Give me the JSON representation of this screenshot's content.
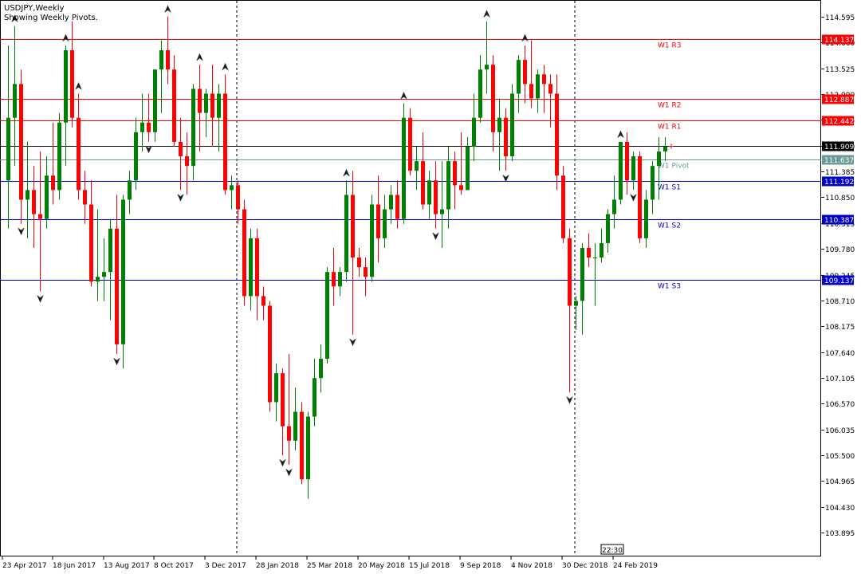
{
  "header": {
    "symbol_line": "USDJPY,Weekly",
    "indicator_line": "Showing Weekly Pivots."
  },
  "clock_label": "22:30",
  "colors": {
    "bull": "#008000",
    "bear": "#ff0000",
    "resistance": "#ff0000",
    "support": "#0000cc",
    "pivot": "#6a9a9a",
    "current": "#000000"
  },
  "chart_data": {
    "type": "candlestick",
    "symbol": "USDJPY",
    "timeframe": "Weekly",
    "ylim": [
      103.4,
      115.0
    ],
    "y_ticks": [
      "114.595",
      "114.060",
      "113.525",
      "112.990",
      "112.455",
      "111.920",
      "111.385",
      "110.850",
      "110.315",
      "109.780",
      "109.245",
      "108.710",
      "108.175",
      "107.640",
      "107.105",
      "106.570",
      "106.035",
      "105.500",
      "104.965",
      "104.430",
      "103.895"
    ],
    "x_ticks": [
      "23 Apr 2017",
      "18 Jun 2017",
      "13 Aug 2017",
      "8 Oct 2017",
      "3 Dec 2017",
      "28 Jan 2018",
      "25 Mar 2018",
      "20 May 2018",
      "15 Jul 2018",
      "9 Sep 2018",
      "4 Nov 2018",
      "30 Dec 2018",
      "24 Feb 2019"
    ],
    "period_separators": [
      "31 Dec 2017",
      "30 Dec 2018"
    ],
    "pivot_levels": [
      {
        "label": "W1 R3",
        "value": 114.137,
        "value_label": "114.137",
        "kind": "resistance"
      },
      {
        "label": "W1 R2",
        "value": 112.887,
        "value_label": "112.887",
        "kind": "resistance"
      },
      {
        "label": "W1 R1",
        "value": 112.442,
        "value_label": "112.442",
        "kind": "resistance"
      },
      {
        "label": "W1 Pivot",
        "value": 111.637,
        "value_label": "111.637",
        "kind": "pivot"
      },
      {
        "label": "W1 S1",
        "value": 111.192,
        "value_label": "111.192",
        "kind": "support"
      },
      {
        "label": "W1 S2",
        "value": 110.387,
        "value_label": "110.387",
        "kind": "support"
      },
      {
        "label": "W1 S3",
        "value": 109.137,
        "value_label": "109.137",
        "kind": "support"
      }
    ],
    "current_price": 111.909,
    "current_price_label": "111.909",
    "candles": [
      {
        "o": 111.2,
        "h": 114.0,
        "l": 110.2,
        "c": 112.5
      },
      {
        "o": 112.5,
        "h": 114.4,
        "l": 111.5,
        "c": 113.2
      },
      {
        "o": 113.2,
        "h": 113.5,
        "l": 110.3,
        "c": 110.8
      },
      {
        "o": 110.8,
        "h": 112.0,
        "l": 110.0,
        "c": 111.0
      },
      {
        "o": 111.0,
        "h": 111.5,
        "l": 109.8,
        "c": 110.5
      },
      {
        "o": 110.5,
        "h": 111.8,
        "l": 108.9,
        "c": 110.4
      },
      {
        "o": 110.4,
        "h": 111.7,
        "l": 110.2,
        "c": 111.3
      },
      {
        "o": 111.3,
        "h": 112.4,
        "l": 110.7,
        "c": 111.0
      },
      {
        "o": 111.0,
        "h": 112.6,
        "l": 110.8,
        "c": 112.4
      },
      {
        "o": 112.4,
        "h": 114.0,
        "l": 111.5,
        "c": 113.9
      },
      {
        "o": 113.9,
        "h": 114.5,
        "l": 112.3,
        "c": 112.5
      },
      {
        "o": 112.5,
        "h": 113.0,
        "l": 110.8,
        "c": 111.0
      },
      {
        "o": 111.0,
        "h": 111.4,
        "l": 110.3,
        "c": 110.7
      },
      {
        "o": 110.7,
        "h": 111.2,
        "l": 109.0,
        "c": 109.1
      },
      {
        "o": 109.1,
        "h": 110.6,
        "l": 108.7,
        "c": 109.2
      },
      {
        "o": 109.2,
        "h": 110.0,
        "l": 108.7,
        "c": 109.3
      },
      {
        "o": 109.3,
        "h": 110.4,
        "l": 108.3,
        "c": 110.2
      },
      {
        "o": 110.2,
        "h": 110.9,
        "l": 107.6,
        "c": 107.8
      },
      {
        "o": 107.8,
        "h": 110.9,
        "l": 107.3,
        "c": 110.8
      },
      {
        "o": 110.8,
        "h": 111.4,
        "l": 110.5,
        "c": 111.2
      },
      {
        "o": 111.2,
        "h": 112.5,
        "l": 111.0,
        "c": 112.2
      },
      {
        "o": 112.2,
        "h": 113.0,
        "l": 111.8,
        "c": 112.4
      },
      {
        "o": 112.4,
        "h": 113.0,
        "l": 112.0,
        "c": 112.2
      },
      {
        "o": 112.2,
        "h": 113.5,
        "l": 112.0,
        "c": 113.5
      },
      {
        "o": 113.5,
        "h": 114.1,
        "l": 112.6,
        "c": 113.9
      },
      {
        "o": 113.9,
        "h": 114.6,
        "l": 113.2,
        "c": 113.5
      },
      {
        "o": 113.5,
        "h": 113.8,
        "l": 111.9,
        "c": 112.0
      },
      {
        "o": 112.0,
        "h": 112.5,
        "l": 111.0,
        "c": 111.7
      },
      {
        "o": 111.7,
        "h": 112.2,
        "l": 110.9,
        "c": 111.5
      },
      {
        "o": 111.5,
        "h": 113.2,
        "l": 111.2,
        "c": 113.1
      },
      {
        "o": 113.1,
        "h": 113.6,
        "l": 111.8,
        "c": 112.6
      },
      {
        "o": 112.6,
        "h": 113.1,
        "l": 112.1,
        "c": 113.0
      },
      {
        "o": 113.0,
        "h": 113.6,
        "l": 111.9,
        "c": 112.5
      },
      {
        "o": 112.5,
        "h": 113.2,
        "l": 111.8,
        "c": 113.0
      },
      {
        "o": 113.0,
        "h": 113.4,
        "l": 110.9,
        "c": 111.0
      },
      {
        "o": 111.0,
        "h": 111.3,
        "l": 110.6,
        "c": 111.1
      },
      {
        "o": 111.1,
        "h": 111.2,
        "l": 110.3,
        "c": 110.6
      },
      {
        "o": 110.6,
        "h": 110.8,
        "l": 108.6,
        "c": 108.8
      },
      {
        "o": 108.8,
        "h": 110.2,
        "l": 108.5,
        "c": 110.0
      },
      {
        "o": 110.0,
        "h": 110.2,
        "l": 108.3,
        "c": 108.8
      },
      {
        "o": 108.8,
        "h": 109.0,
        "l": 108.3,
        "c": 108.6
      },
      {
        "o": 108.6,
        "h": 108.7,
        "l": 106.4,
        "c": 106.6
      },
      {
        "o": 106.6,
        "h": 107.4,
        "l": 106.2,
        "c": 107.2
      },
      {
        "o": 107.2,
        "h": 107.3,
        "l": 105.5,
        "c": 106.1
      },
      {
        "o": 106.1,
        "h": 107.6,
        "l": 105.3,
        "c": 105.8
      },
      {
        "o": 105.8,
        "h": 106.9,
        "l": 105.6,
        "c": 106.4
      },
      {
        "o": 106.4,
        "h": 106.6,
        "l": 104.9,
        "c": 105.0
      },
      {
        "o": 105.0,
        "h": 106.4,
        "l": 104.6,
        "c": 106.3
      },
      {
        "o": 106.3,
        "h": 107.5,
        "l": 106.1,
        "c": 107.1
      },
      {
        "o": 107.1,
        "h": 107.8,
        "l": 106.8,
        "c": 107.5
      },
      {
        "o": 107.5,
        "h": 109.4,
        "l": 107.4,
        "c": 109.3
      },
      {
        "o": 109.3,
        "h": 109.8,
        "l": 108.6,
        "c": 109.0
      },
      {
        "o": 109.0,
        "h": 109.4,
        "l": 108.8,
        "c": 109.3
      },
      {
        "o": 109.3,
        "h": 111.2,
        "l": 109.1,
        "c": 110.9
      },
      {
        "o": 110.9,
        "h": 111.4,
        "l": 108.0,
        "c": 109.6
      },
      {
        "o": 109.6,
        "h": 109.8,
        "l": 109.2,
        "c": 109.4
      },
      {
        "o": 109.4,
        "h": 109.6,
        "l": 108.8,
        "c": 109.2
      },
      {
        "o": 109.2,
        "h": 110.9,
        "l": 109.1,
        "c": 110.7
      },
      {
        "o": 110.7,
        "h": 111.3,
        "l": 109.5,
        "c": 110.0
      },
      {
        "o": 110.0,
        "h": 110.9,
        "l": 109.8,
        "c": 110.6
      },
      {
        "o": 110.6,
        "h": 111.1,
        "l": 110.3,
        "c": 110.9
      },
      {
        "o": 110.9,
        "h": 111.2,
        "l": 110.2,
        "c": 110.4
      },
      {
        "o": 110.4,
        "h": 112.8,
        "l": 110.3,
        "c": 112.5
      },
      {
        "o": 112.5,
        "h": 112.7,
        "l": 111.3,
        "c": 111.4
      },
      {
        "o": 111.4,
        "h": 111.9,
        "l": 111.0,
        "c": 111.6
      },
      {
        "o": 111.6,
        "h": 112.2,
        "l": 110.6,
        "c": 110.7
      },
      {
        "o": 110.7,
        "h": 111.4,
        "l": 110.4,
        "c": 111.2
      },
      {
        "o": 111.2,
        "h": 111.6,
        "l": 110.2,
        "c": 110.5
      },
      {
        "o": 110.5,
        "h": 111.6,
        "l": 109.8,
        "c": 110.6
      },
      {
        "o": 110.6,
        "h": 111.9,
        "l": 110.2,
        "c": 111.6
      },
      {
        "o": 111.6,
        "h": 111.8,
        "l": 110.6,
        "c": 111.1
      },
      {
        "o": 111.1,
        "h": 112.2,
        "l": 110.9,
        "c": 111.0
      },
      {
        "o": 111.0,
        "h": 112.1,
        "l": 111.0,
        "c": 111.9
      },
      {
        "o": 111.9,
        "h": 113.0,
        "l": 111.6,
        "c": 112.5
      },
      {
        "o": 112.5,
        "h": 113.8,
        "l": 112.4,
        "c": 113.5
      },
      {
        "o": 113.5,
        "h": 114.5,
        "l": 113.0,
        "c": 113.6
      },
      {
        "o": 113.6,
        "h": 113.8,
        "l": 111.8,
        "c": 112.2
      },
      {
        "o": 112.2,
        "h": 112.9,
        "l": 111.4,
        "c": 112.5
      },
      {
        "o": 112.5,
        "h": 112.7,
        "l": 111.4,
        "c": 111.7
      },
      {
        "o": 111.7,
        "h": 113.2,
        "l": 111.6,
        "c": 113.0
      },
      {
        "o": 113.0,
        "h": 113.8,
        "l": 112.6,
        "c": 113.7
      },
      {
        "o": 113.7,
        "h": 114.0,
        "l": 112.8,
        "c": 113.2
      },
      {
        "o": 113.2,
        "h": 114.1,
        "l": 112.7,
        "c": 112.9
      },
      {
        "o": 112.9,
        "h": 113.5,
        "l": 112.6,
        "c": 113.4
      },
      {
        "o": 113.4,
        "h": 113.6,
        "l": 112.6,
        "c": 113.2
      },
      {
        "o": 113.2,
        "h": 113.4,
        "l": 112.3,
        "c": 113.0
      },
      {
        "o": 113.0,
        "h": 113.4,
        "l": 111.0,
        "c": 111.3
      },
      {
        "o": 111.3,
        "h": 111.5,
        "l": 109.9,
        "c": 110.0
      },
      {
        "o": 110.0,
        "h": 110.2,
        "l": 106.8,
        "c": 108.6
      },
      {
        "o": 108.6,
        "h": 108.8,
        "l": 108.1,
        "c": 108.7
      },
      {
        "o": 108.7,
        "h": 109.9,
        "l": 108.0,
        "c": 109.8
      },
      {
        "o": 109.8,
        "h": 110.1,
        "l": 109.4,
        "c": 109.6
      },
      {
        "o": 109.6,
        "h": 109.9,
        "l": 108.6,
        "c": 109.6
      },
      {
        "o": 109.6,
        "h": 110.2,
        "l": 109.5,
        "c": 109.9
      },
      {
        "o": 109.9,
        "h": 110.6,
        "l": 109.7,
        "c": 110.5
      },
      {
        "o": 110.5,
        "h": 111.3,
        "l": 110.2,
        "c": 110.8
      },
      {
        "o": 110.8,
        "h": 112.0,
        "l": 110.7,
        "c": 112.0
      },
      {
        "o": 112.0,
        "h": 112.2,
        "l": 110.9,
        "c": 111.2
      },
      {
        "o": 111.2,
        "h": 111.8,
        "l": 111.0,
        "c": 111.7
      },
      {
        "o": 111.7,
        "h": 111.8,
        "l": 109.9,
        "c": 110.0
      },
      {
        "o": 110.0,
        "h": 111.0,
        "l": 109.8,
        "c": 110.8
      },
      {
        "o": 110.8,
        "h": 111.6,
        "l": 110.5,
        "c": 111.5
      },
      {
        "o": 111.5,
        "h": 112.1,
        "l": 110.8,
        "c": 111.8
      },
      {
        "o": 111.8,
        "h": 112.1,
        "l": 111.6,
        "c": 111.9
      }
    ],
    "fractals": [
      {
        "i": 1,
        "dir": "up"
      },
      {
        "i": 2,
        "dir": "down"
      },
      {
        "i": 5,
        "dir": "down"
      },
      {
        "i": 9,
        "dir": "up"
      },
      {
        "i": 11,
        "dir": "up"
      },
      {
        "i": 17,
        "dir": "down"
      },
      {
        "i": 22,
        "dir": "down"
      },
      {
        "i": 25,
        "dir": "up"
      },
      {
        "i": 27,
        "dir": "down"
      },
      {
        "i": 30,
        "dir": "up"
      },
      {
        "i": 34,
        "dir": "up"
      },
      {
        "i": 43,
        "dir": "down"
      },
      {
        "i": 44,
        "dir": "down"
      },
      {
        "i": 53,
        "dir": "up"
      },
      {
        "i": 54,
        "dir": "down"
      },
      {
        "i": 62,
        "dir": "up"
      },
      {
        "i": 67,
        "dir": "down"
      },
      {
        "i": 75,
        "dir": "up"
      },
      {
        "i": 78,
        "dir": "down"
      },
      {
        "i": 81,
        "dir": "up"
      },
      {
        "i": 88,
        "dir": "down"
      },
      {
        "i": 96,
        "dir": "up"
      },
      {
        "i": 98,
        "dir": "down"
      }
    ]
  }
}
